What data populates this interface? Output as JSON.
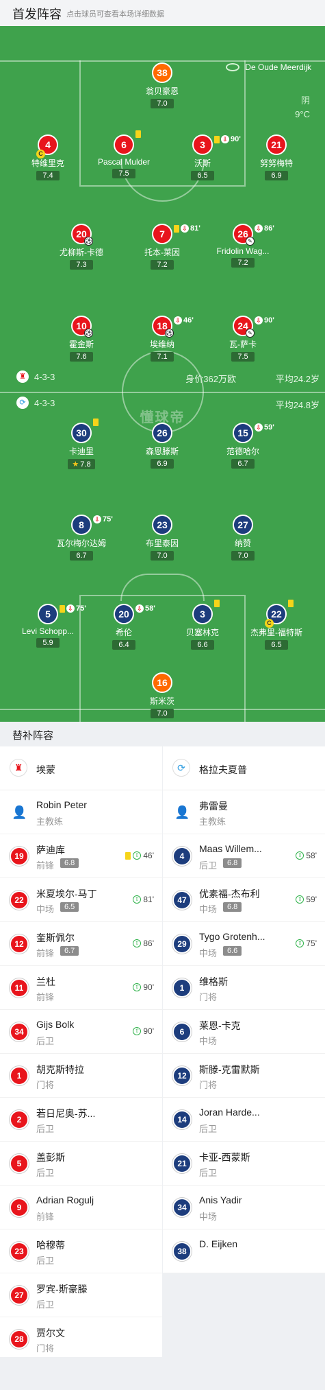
{
  "header": {
    "title": "首发阵容",
    "subtitle": "点击球员可查看本场详细数据"
  },
  "venue": {
    "name": "De Oude Meerdijk"
  },
  "weather": {
    "condition": "阴",
    "temperature": "9°C"
  },
  "home_team": {
    "formation": "4-3-3",
    "value": "身价362万欧",
    "avg_age": "平均24.2岁",
    "color": "#e8151c"
  },
  "away_team": {
    "formation": "4-3-3",
    "avg_age": "平均24.8岁",
    "color": "#1d3d7d"
  },
  "watermark": "懂球帝",
  "starters": [
    {
      "no": "38",
      "name": "翁贝豪恩",
      "rating": "7.0",
      "team": "orange"
    },
    {
      "no": "4",
      "name": "特维里克",
      "rating": "7.4",
      "team": "red",
      "captain": "C"
    },
    {
      "no": "6",
      "name": "Pascal Mulder",
      "rating": "7.5",
      "team": "red"
    },
    {
      "no": "3",
      "name": "沃斯",
      "rating": "6.5",
      "team": "red",
      "event": "90'"
    },
    {
      "no": "21",
      "name": "努努梅特",
      "rating": "6.9",
      "team": "red"
    },
    {
      "no": "20",
      "name": "尤柳斯-卡德",
      "rating": "7.3",
      "team": "red"
    },
    {
      "no": "7",
      "name": "托本-莱因",
      "rating": "7.2",
      "team": "red",
      "event": "81'"
    },
    {
      "no": "26",
      "name": "Fridolin Wag...",
      "rating": "7.2",
      "team": "red",
      "event": "86'"
    },
    {
      "no": "10",
      "name": "霍金斯",
      "rating": "7.6",
      "team": "red"
    },
    {
      "no": "18",
      "name": "埃维纳",
      "rating": "7.1",
      "team": "red",
      "event": "46'"
    },
    {
      "no": "24",
      "name": "瓦-萨卡",
      "rating": "7.5",
      "team": "red",
      "event": "90'"
    },
    {
      "no": "30",
      "name": "卡迪里",
      "rating": "7.8",
      "team": "blue"
    },
    {
      "no": "26",
      "name": "森恩滕斯",
      "rating": "6.9",
      "team": "blue"
    },
    {
      "no": "15",
      "name": "范德哈尔",
      "rating": "6.7",
      "team": "blue",
      "event": "59'"
    },
    {
      "no": "8",
      "name": "瓦尔梅尔达姆",
      "rating": "6.7",
      "team": "blue",
      "event": "75'"
    },
    {
      "no": "23",
      "name": "布里泰因",
      "rating": "7.0",
      "team": "blue"
    },
    {
      "no": "27",
      "name": "纳赞",
      "rating": "7.0",
      "team": "blue"
    },
    {
      "no": "5",
      "name": "Levi Schopp...",
      "rating": "5.9",
      "team": "blue",
      "event": "75'"
    },
    {
      "no": "20",
      "name": "希伦",
      "rating": "6.4",
      "team": "blue",
      "event": "58'"
    },
    {
      "no": "3",
      "name": "贝塞林克",
      "rating": "6.6",
      "team": "blue"
    },
    {
      "no": "22",
      "name": "杰弗里-福特斯",
      "rating": "6.5",
      "team": "blue",
      "captain": "C"
    },
    {
      "no": "16",
      "name": "斯米茨",
      "rating": "7.0",
      "team": "orange"
    }
  ],
  "subs": {
    "title": "替补阵容",
    "home": {
      "team_name": "埃蒙",
      "coach": {
        "name": "Robin Peter",
        "role": "主教练"
      },
      "players": [
        {
          "no": "19",
          "name": "萨迪库",
          "pos": "前锋",
          "rating": "6.8",
          "minute": "46'"
        },
        {
          "no": "22",
          "name": "米夏埃尔-马丁",
          "pos": "中场",
          "rating": "6.5",
          "minute": "81'"
        },
        {
          "no": "12",
          "name": "奎斯佩尔",
          "pos": "前锋",
          "rating": "6.7",
          "minute": "86'"
        },
        {
          "no": "11",
          "name": "兰杜",
          "pos": "前锋",
          "rating": "",
          "minute": "90'"
        },
        {
          "no": "34",
          "name": "Gijs Bolk",
          "pos": "后卫",
          "rating": "",
          "minute": "90'"
        },
        {
          "no": "1",
          "name": "胡克斯特拉",
          "pos": "门将",
          "rating": "",
          "minute": ""
        },
        {
          "no": "2",
          "name": "若日尼奥-苏...",
          "pos": "后卫",
          "rating": "",
          "minute": ""
        },
        {
          "no": "5",
          "name": "盖彭斯",
          "pos": "后卫",
          "rating": "",
          "minute": ""
        },
        {
          "no": "9",
          "name": "Adrian Rogulj",
          "pos": "前锋",
          "rating": "",
          "minute": ""
        },
        {
          "no": "23",
          "name": "哈穆蒂",
          "pos": "后卫",
          "rating": "",
          "minute": ""
        },
        {
          "no": "27",
          "name": "罗宾-斯豪滕",
          "pos": "后卫",
          "rating": "",
          "minute": ""
        },
        {
          "no": "28",
          "name": "贾尔文",
          "pos": "门将",
          "rating": "",
          "minute": ""
        }
      ]
    },
    "away": {
      "team_name": "格拉夫夏普",
      "coach": {
        "name": "弗雷曼",
        "role": "主教练"
      },
      "players": [
        {
          "no": "4",
          "name": "Maas Willem...",
          "pos": "后卫",
          "rating": "6.8",
          "minute": "58'"
        },
        {
          "no": "47",
          "name": "优素福-杰布利",
          "pos": "中场",
          "rating": "6.8",
          "minute": "59'"
        },
        {
          "no": "29",
          "name": "Tygo Grotenh...",
          "pos": "中场",
          "rating": "6.6",
          "minute": "75'"
        },
        {
          "no": "1",
          "name": "维格斯",
          "pos": "门将",
          "rating": "",
          "minute": ""
        },
        {
          "no": "6",
          "name": "莱恩-卡克",
          "pos": "中场",
          "rating": "",
          "minute": ""
        },
        {
          "no": "12",
          "name": "斯滕-克雷默斯",
          "pos": "门将",
          "rating": "",
          "minute": ""
        },
        {
          "no": "14",
          "name": "Joran Harde...",
          "pos": "后卫",
          "rating": "",
          "minute": ""
        },
        {
          "no": "21",
          "name": "卡亚-西蒙斯",
          "pos": "后卫",
          "rating": "",
          "minute": ""
        },
        {
          "no": "34",
          "name": "Anis Yadir",
          "pos": "中场",
          "rating": "",
          "minute": ""
        },
        {
          "no": "38",
          "name": "D. Eijken",
          "pos": "",
          "rating": "",
          "minute": ""
        }
      ]
    }
  }
}
